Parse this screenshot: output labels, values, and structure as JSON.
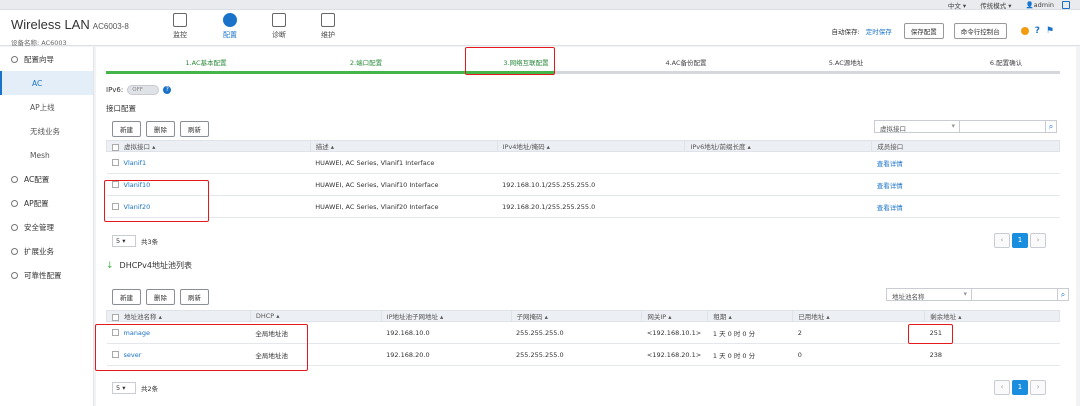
{
  "topbar": {
    "lang": "中文 ▾",
    "mode": "传统模式 ▾",
    "user": "admin"
  },
  "header": {
    "brand": "Wireless LAN",
    "model": "AC6003-8",
    "device_name": "设备名称:  AC6003",
    "nav": [
      {
        "label": "监控",
        "icon": "monitor-icon"
      },
      {
        "label": "配置",
        "icon": "gear-icon"
      },
      {
        "label": "诊断",
        "icon": "sliders-icon"
      },
      {
        "label": "维护",
        "icon": "maintenance-icon"
      }
    ],
    "autosave_label": "自动保存:",
    "autosave_link": "定时保存",
    "save_config": "保存配置",
    "cli_console": "命令行控制台"
  },
  "sidebar": {
    "items": [
      {
        "label": "配置向导",
        "type": "group"
      },
      {
        "label": "AC",
        "type": "sub"
      },
      {
        "label": "AP上线",
        "type": "sub"
      },
      {
        "label": "无线业务",
        "type": "sub"
      },
      {
        "label": "Mesh",
        "type": "sub"
      },
      {
        "label": "AC配置",
        "type": "group"
      },
      {
        "label": "AP配置",
        "type": "group"
      },
      {
        "label": "安全管理",
        "type": "group"
      },
      {
        "label": "扩展业务",
        "type": "group"
      },
      {
        "label": "可靠性配置",
        "type": "group"
      }
    ]
  },
  "wizard": {
    "steps": [
      "1.AC基本配置",
      "2.端口配置",
      "3.网络互联配置",
      "4.AC备份配置",
      "5.AC源地址",
      "6.配置确认"
    ],
    "progress_fraction": 0.47
  },
  "ipv6": {
    "label": "IPv6:",
    "state": "OFF"
  },
  "interfaces": {
    "title": "接口配置",
    "buttons": [
      "新建",
      "删除",
      "刷新"
    ],
    "search_select": "虚拟接口",
    "columns": [
      "虚拟接口 ▴",
      "描述 ▴",
      "IPv4地址/掩码 ▴",
      "IPv6地址/前缀长度 ▴",
      "成员接口"
    ],
    "rows": [
      {
        "name": "Vlanif1",
        "desc": "HUAWEI, AC Series, Vlanif1 Interface",
        "ipv4": "",
        "ipv6": "",
        "member": "查看详情"
      },
      {
        "name": "Vlanif10",
        "desc": "HUAWEI, AC Series, Vlanif10 Interface",
        "ipv4": "192.168.10.1/255.255.255.0",
        "ipv6": "",
        "member": "查看详情"
      },
      {
        "name": "Vlanif20",
        "desc": "HUAWEI, AC Series, Vlanif20 Interface",
        "ipv4": "192.168.20.1/255.255.255.0",
        "ipv6": "",
        "member": "查看详情"
      }
    ],
    "page_size": "5",
    "total": "共3条",
    "page": "1"
  },
  "dhcp": {
    "title": "DHCPv4地址池列表",
    "buttons": [
      "新建",
      "删除",
      "刷新"
    ],
    "search_select": "地址池名称",
    "columns": [
      "地址池名称 ▴",
      "DHCP ▴",
      "IP地址池子网地址 ▴",
      "子网掩码 ▴",
      "网关IP ▴",
      "租期 ▴",
      "已用地址 ▴",
      "剩余地址 ▴"
    ],
    "rows": [
      {
        "name": "manage",
        "dhcp": "全局地址池",
        "subnet": "192.168.10.0",
        "mask": "255.255.255.0",
        "gw": "<192.168.10.1>",
        "lease": "1 天 0 时 0 分",
        "used": "2",
        "free": "251"
      },
      {
        "name": "sever",
        "dhcp": "全局地址池",
        "subnet": "192.168.20.0",
        "mask": "255.255.255.0",
        "gw": "<192.168.20.1>",
        "lease": "1 天 0 时 0 分",
        "used": "0",
        "free": "238"
      }
    ],
    "page_size": "5",
    "total": "共2条",
    "page": "1"
  },
  "colors": {
    "accent": "#1a73c8",
    "progress": "#44b549",
    "highlight": "#e3191c"
  }
}
